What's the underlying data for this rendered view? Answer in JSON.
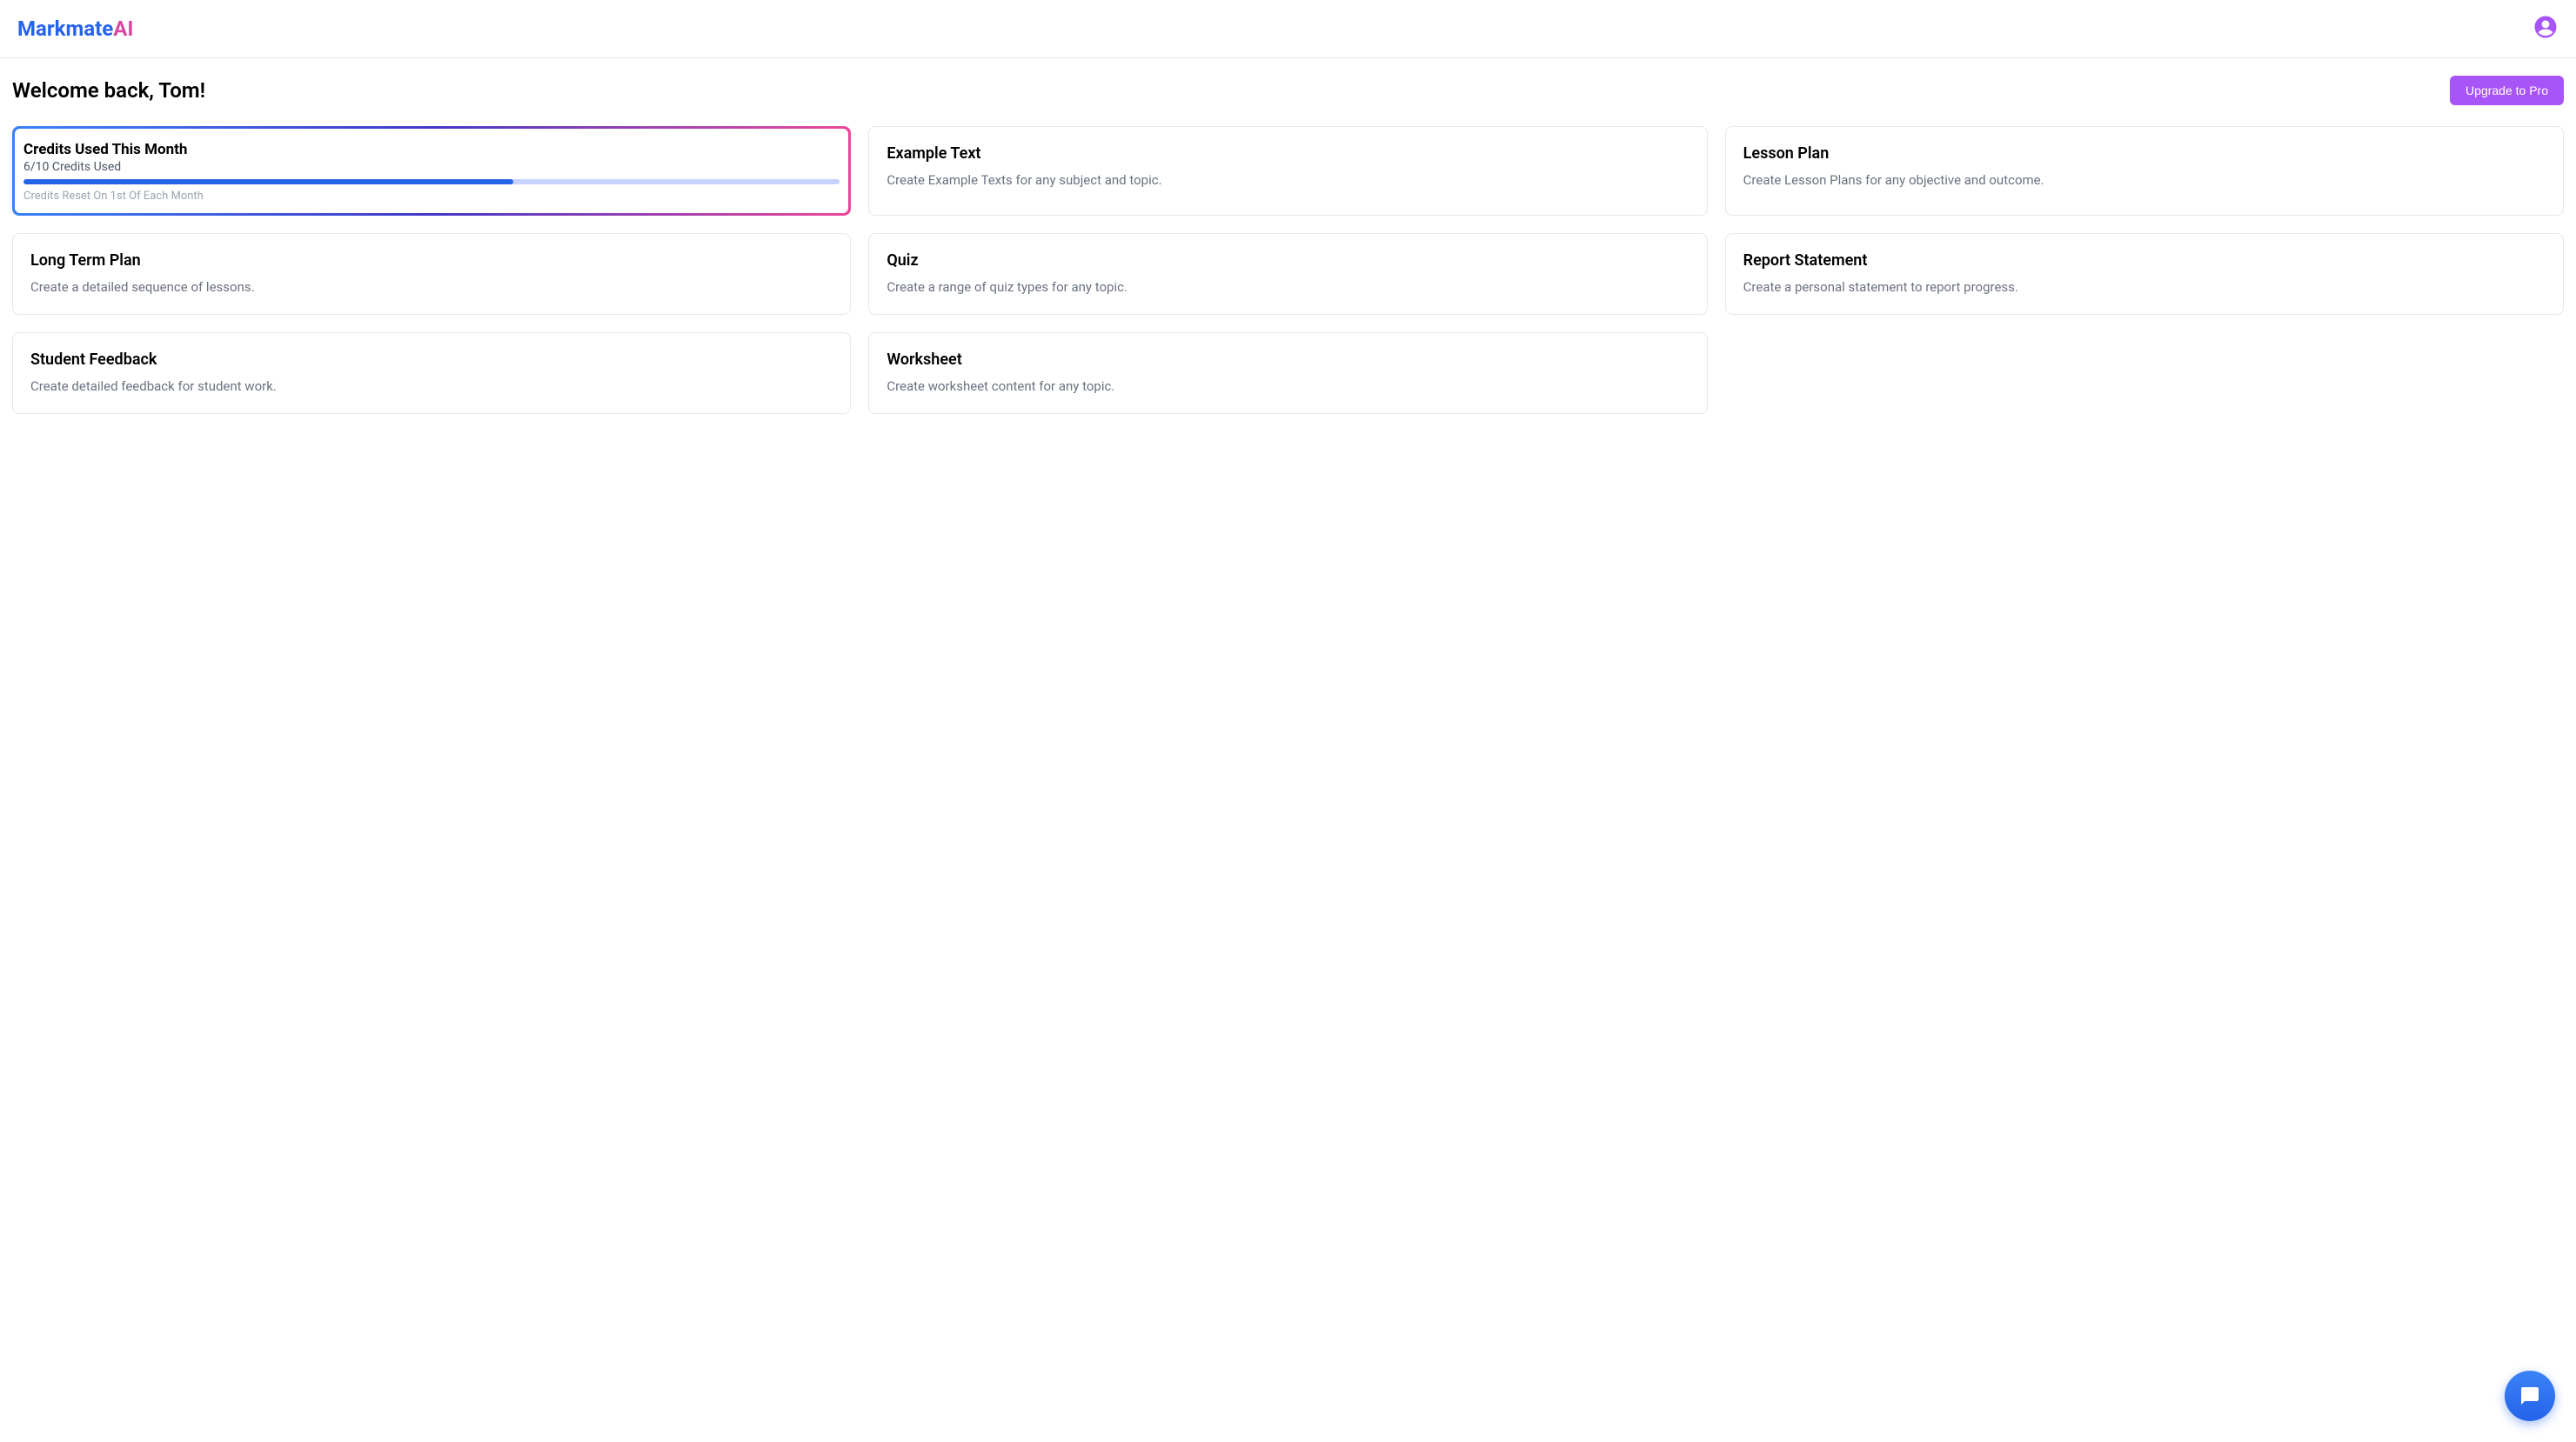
{
  "header": {
    "logo_markmate": "Markmate",
    "logo_ai": "AI"
  },
  "topbar": {
    "welcome": "Welcome back, Tom!",
    "upgrade_label": "Upgrade to Pro"
  },
  "credits": {
    "title": "Credits Used This Month",
    "used_text": "6/10 Credits Used",
    "reset_text": "Credits Reset On 1st Of Each Month",
    "progress_percent": 60
  },
  "cards": [
    {
      "title": "Example Text",
      "desc": "Create Example Texts for any subject and topic."
    },
    {
      "title": "Lesson Plan",
      "desc": "Create Lesson Plans for any objective and outcome."
    },
    {
      "title": "Long Term Plan",
      "desc": "Create a detailed sequence of lessons."
    },
    {
      "title": "Quiz",
      "desc": "Create a range of quiz types for any topic."
    },
    {
      "title": "Report Statement",
      "desc": "Create a personal statement to report progress."
    },
    {
      "title": "Student Feedback",
      "desc": "Create detailed feedback for student work."
    },
    {
      "title": "Worksheet",
      "desc": "Create worksheet content for any topic."
    }
  ],
  "colors": {
    "blue": "#2563eb",
    "pink": "#d946a1",
    "purple": "#a855f7",
    "gray_text": "#6b7280",
    "light_gray_text": "#9ca3af",
    "progress_bg": "#c7d2fe"
  }
}
